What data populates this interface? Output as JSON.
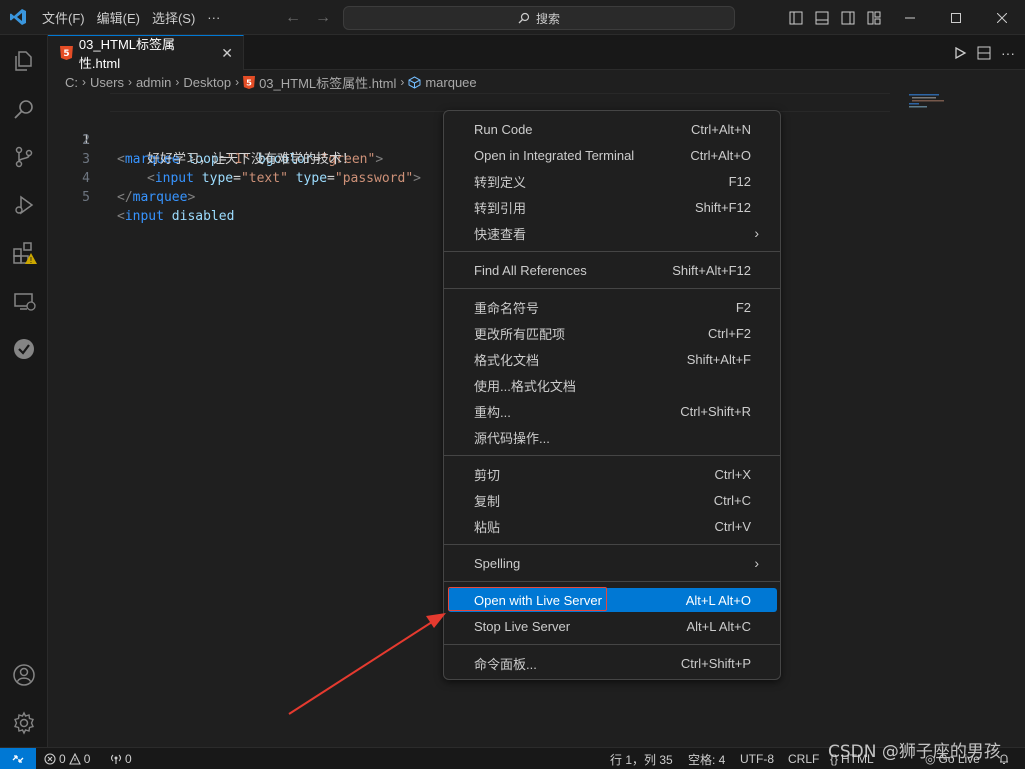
{
  "titlebar": {
    "menus": [
      "文件(F)",
      "编辑(E)",
      "选择(S)",
      "···"
    ],
    "search_label": "搜索"
  },
  "tab": {
    "filename": "03_HTML标签属性.html",
    "close": "✕"
  },
  "breadcrumb": [
    "C:",
    "Users",
    "admin",
    "Desktop",
    "03_HTML标签属性.html",
    "marquee"
  ],
  "editor": {
    "lines": [
      {
        "num": "1"
      },
      {
        "num": "2",
        "text": "好好学习，让天下没有难学的技术！"
      },
      {
        "num": "3"
      },
      {
        "num": "4"
      },
      {
        "num": "5"
      }
    ],
    "tokens": {
      "l1_open": "<",
      "l1_tag": "marquee",
      "l1_attr1": " loop",
      "l1_eq1": "=",
      "l1_val1": "\"1\"",
      "l1_attr2": " bgcolor",
      "l1_eq2": "=",
      "l1_val2": "\"green\"",
      "l1_close": ">",
      "l3_open": "<",
      "l3_tag": "input",
      "l3_attr1": " type",
      "l3_eq1": "=",
      "l3_val1": "\"text\"",
      "l3_attr2": " type",
      "l3_eq2": "=",
      "l3_val2": "\"password\"",
      "l3_close": ">",
      "l4_open": "</",
      "l4_tag": "marquee",
      "l4_close": ">",
      "l5_open": "<",
      "l5_tag": "input",
      "l5_attr": " disabled"
    }
  },
  "context_menu": {
    "items": [
      {
        "label": "Run Code",
        "shortcut": "Ctrl+Alt+N"
      },
      {
        "label": "Open in Integrated Terminal",
        "shortcut": "Ctrl+Alt+O"
      },
      {
        "label": "转到定义",
        "shortcut": "F12"
      },
      {
        "label": "转到引用",
        "shortcut": "Shift+F12"
      },
      {
        "label": "快速查看",
        "shortcut": ""
      },
      {
        "label": "Find All References",
        "shortcut": "Shift+Alt+F12"
      },
      {
        "label": "重命名符号",
        "shortcut": "F2"
      },
      {
        "label": "更改所有匹配项",
        "shortcut": "Ctrl+F2"
      },
      {
        "label": "格式化文档",
        "shortcut": "Shift+Alt+F"
      },
      {
        "label": "使用...格式化文档",
        "shortcut": ""
      },
      {
        "label": "重构...",
        "shortcut": "Ctrl+Shift+R"
      },
      {
        "label": "源代码操作...",
        "shortcut": ""
      },
      {
        "label": "剪切",
        "shortcut": "Ctrl+X"
      },
      {
        "label": "复制",
        "shortcut": "Ctrl+C"
      },
      {
        "label": "粘贴",
        "shortcut": "Ctrl+V"
      },
      {
        "label": "Spelling",
        "shortcut": ""
      },
      {
        "label": "Open with Live Server",
        "shortcut": "Alt+L Alt+O"
      },
      {
        "label": "Stop Live Server",
        "shortcut": "Alt+L Alt+C"
      },
      {
        "label": "命令面板...",
        "shortcut": "Ctrl+Shift+P"
      }
    ]
  },
  "statusbar": {
    "errors": "0",
    "warnings": "0",
    "ports": "0",
    "position": "行 1，列 35",
    "spaces": "空格: 4",
    "encoding": "UTF-8",
    "eol": "CRLF",
    "language": "HTML",
    "golive": "Go Live"
  },
  "watermark": "CSDN @狮子座的男孩",
  "colors": {
    "accent": "#0078d4",
    "highlight_outline": "#e5483c",
    "arrow": "#e53a2f",
    "html_icon": "#e44d26"
  }
}
